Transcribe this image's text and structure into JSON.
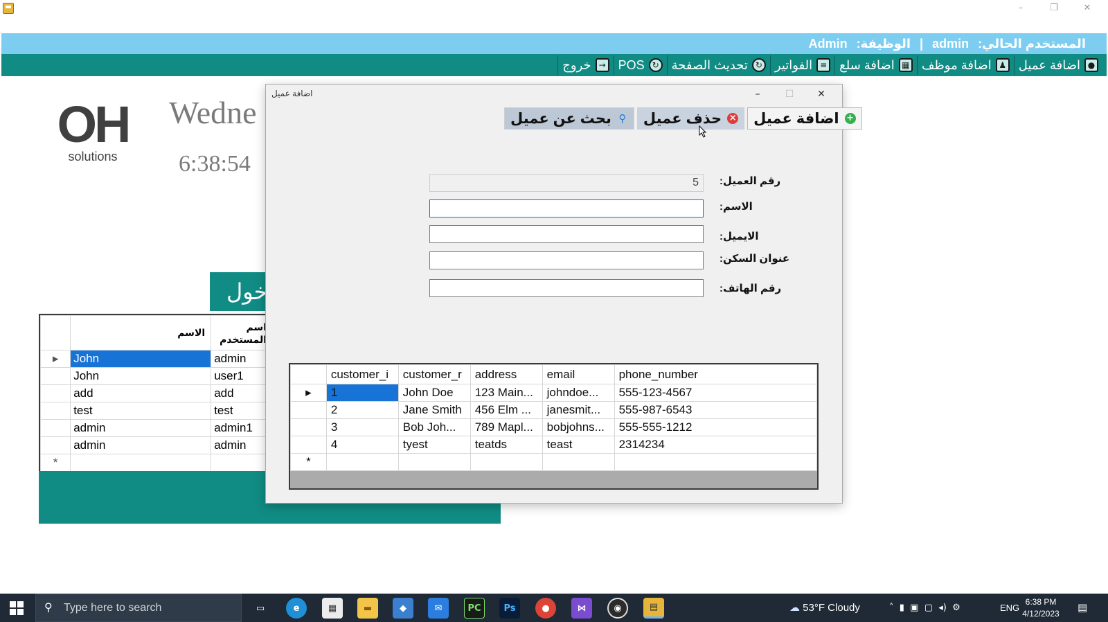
{
  "window": {
    "minimize": "–",
    "maximize": "❐",
    "close": "✕"
  },
  "userbar": {
    "label_current_user": "المستخدم الحالي:",
    "current_user": "admin",
    "separator": "|",
    "label_role": "الوظيفة:",
    "role": "Admin"
  },
  "menu": {
    "items": [
      {
        "label": "اضافة عميل",
        "icon": "person-icon"
      },
      {
        "label": "اضافة موظف",
        "icon": "employee-icon"
      },
      {
        "label": "اضافة سلع",
        "icon": "products-icon"
      },
      {
        "label": "الفواتير",
        "icon": "invoices-icon"
      },
      {
        "label": "تحديث الصفحة",
        "icon": "refresh-icon"
      },
      {
        "label": "POS",
        "icon": "pos-icon"
      },
      {
        "label": "خروج",
        "icon": "exit-icon"
      }
    ]
  },
  "dashboard": {
    "logo_mark": "OH",
    "logo_sub": "solutions",
    "day": "Wedne",
    "time": "6:38:54",
    "login_button": "خول",
    "users_grid": {
      "columns": [
        "الاسم",
        "اسم المستخدم"
      ],
      "rows": [
        {
          "name": "John",
          "username": "admin"
        },
        {
          "name": "John",
          "username": "user1"
        },
        {
          "name": "add",
          "username": "add"
        },
        {
          "name": "test",
          "username": "test"
        },
        {
          "name": "admin",
          "username": "admin1"
        },
        {
          "name": "admin",
          "username": "admin"
        }
      ]
    }
  },
  "dialog": {
    "title": "اضافة عميل",
    "toolbar": {
      "add": "اضافة عميل",
      "delete": "حذف عميل",
      "search": "بحث عن عميل"
    },
    "form": {
      "id_label": "رقم العميل:",
      "id_value": "5",
      "name_label": "الاسم:",
      "name_value": "",
      "email_label": "الايميل:",
      "email_value": "",
      "address_label": "عنوان السكن:",
      "address_value": "",
      "phone_label": "رقم الهاتف:",
      "phone_value": ""
    },
    "grid": {
      "columns": [
        "customer_i",
        "customer_r",
        "address",
        "email",
        "phone_number"
      ],
      "rows": [
        {
          "id": "1",
          "name": "John Doe",
          "address": "123 Main...",
          "email": "johndoe...",
          "phone": "555-123-4567"
        },
        {
          "id": "2",
          "name": "Jane Smith",
          "address": "456 Elm ...",
          "email": "janesmit...",
          "phone": "555-987-6543"
        },
        {
          "id": "3",
          "name": "Bob Joh...",
          "address": "789 Mapl...",
          "email": "bobjohns...",
          "phone": "555-555-1212"
        },
        {
          "id": "4",
          "name": "tyest",
          "address": "teatds",
          "email": "teast",
          "phone": "2314234"
        }
      ]
    }
  },
  "taskbar": {
    "search_placeholder": "Type here to search",
    "weather": "53°F Cloudy",
    "language": "ENG",
    "time": "6:38 PM",
    "date": "4/12/2023"
  },
  "colors": {
    "teal": "#108c84",
    "userbar": "#7ccdf0",
    "selection": "#1873d6",
    "taskbar": "#1f2a36"
  }
}
